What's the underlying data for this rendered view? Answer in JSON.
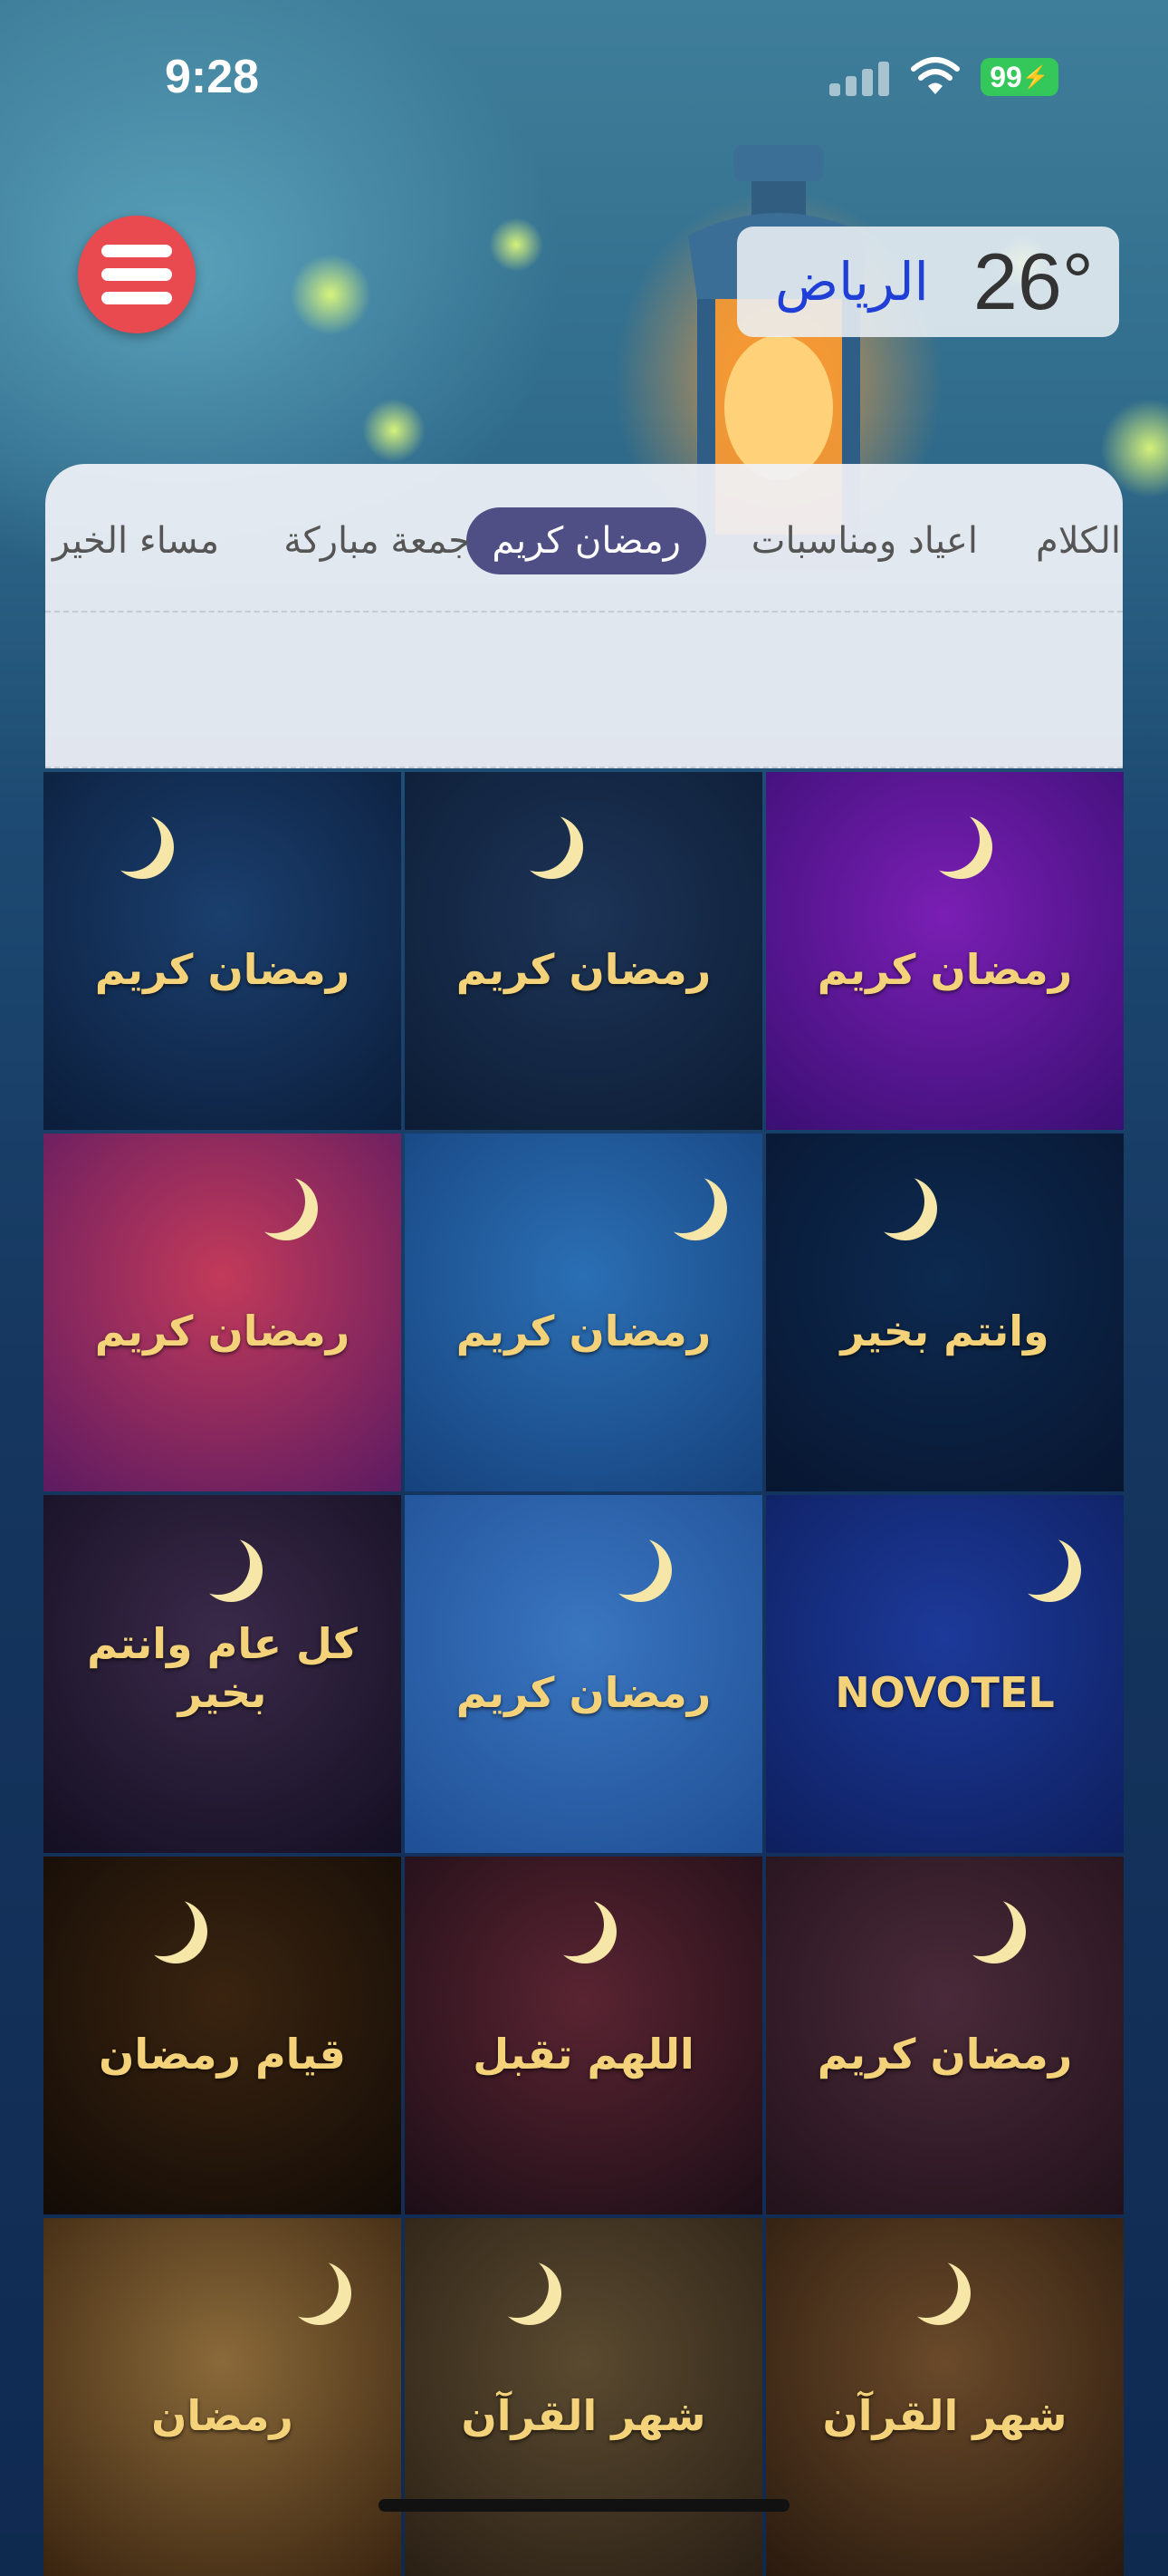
{
  "status_bar": {
    "time": "9:28",
    "battery": "99"
  },
  "weather": {
    "temperature": "26°",
    "city": "الرياض"
  },
  "tabs": [
    {
      "label": "الكلام",
      "active": false
    },
    {
      "label": "اعياد ومناسبات",
      "active": false
    },
    {
      "label": "رمضان كريم",
      "active": true
    },
    {
      "label": "جمعة مباركة",
      "active": false
    },
    {
      "label": "مساء الخير",
      "active": false
    }
  ],
  "gallery": [
    {
      "caption": "رمضان كريم",
      "colors": [
        "#1b3f6e",
        "#0b1d3a"
      ]
    },
    {
      "caption": "رمضان كريم",
      "colors": [
        "#1d3457",
        "#0c1c34"
      ]
    },
    {
      "caption": "رمضان كريم",
      "colors": [
        "#7a1fb4",
        "#3a0f73"
      ]
    },
    {
      "caption": "رمضان كريم",
      "colors": [
        "#c23a5a",
        "#5c1b61"
      ]
    },
    {
      "caption": "رمضان كريم",
      "colors": [
        "#2b6fb4",
        "#16427d"
      ]
    },
    {
      "caption": "وانتم بخير",
      "colors": [
        "#0d2a50",
        "#081630"
      ]
    },
    {
      "caption": "كل عام وانتم بخير",
      "colors": [
        "#3a2a4a",
        "#140f22"
      ]
    },
    {
      "caption": "رمضان كريم",
      "colors": [
        "#3a76c0",
        "#1f4f95"
      ]
    },
    {
      "caption": "NOVOTEL",
      "colors": [
        "#1d3a9a",
        "#0e1f5e"
      ]
    },
    {
      "caption": "قيام رمضان",
      "colors": [
        "#3a2410",
        "#120b06"
      ]
    },
    {
      "caption": "اللهم تقبل",
      "colors": [
        "#5a2432",
        "#1c0e16"
      ]
    },
    {
      "caption": "رمضان كريم",
      "colors": [
        "#4a2a3a",
        "#22121a"
      ]
    },
    {
      "caption": "رمضان",
      "colors": [
        "#8a6a3a",
        "#3a2410"
      ]
    },
    {
      "caption": "شهر القرآن",
      "colors": [
        "#5a4a30",
        "#2a2015"
      ]
    },
    {
      "caption": "شهر القرآن",
      "colors": [
        "#6a4a2a",
        "#2a1a0e"
      ]
    }
  ]
}
